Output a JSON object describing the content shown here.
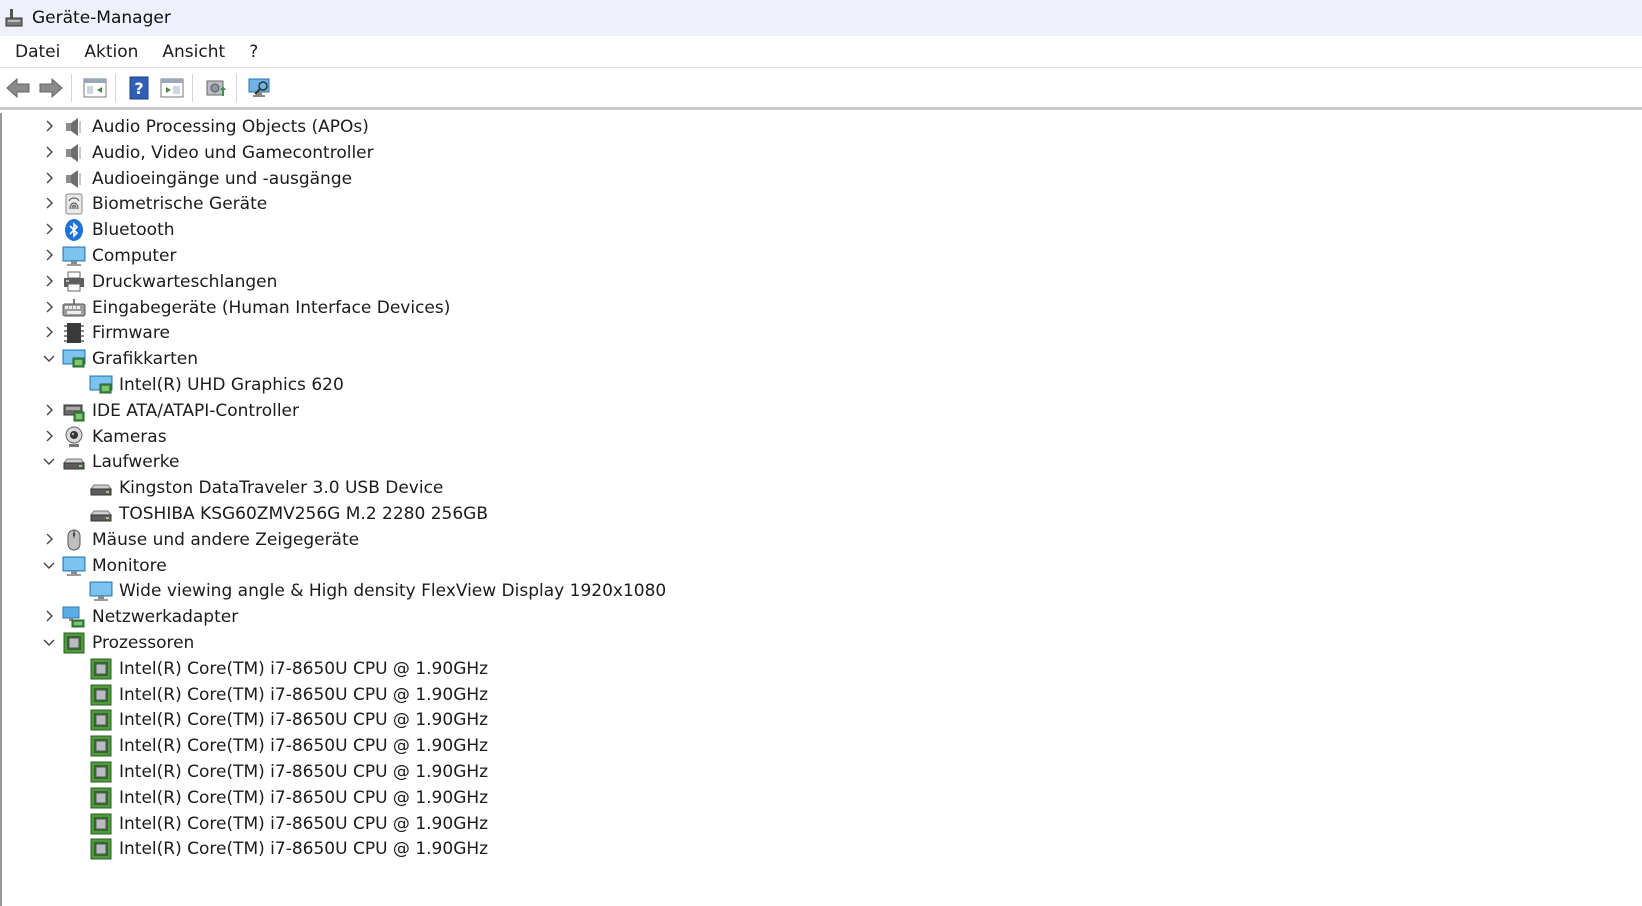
{
  "window": {
    "title": "Geräte-Manager"
  },
  "menu": [
    "Datei",
    "Aktion",
    "Ansicht",
    "?"
  ],
  "toolbar": [
    "back-icon",
    "forward-icon",
    "properties-view-icon",
    "help-icon",
    "details-view-icon",
    "update-driver-icon",
    "scan-hardware-icon"
  ],
  "tree": [
    {
      "label": "Audio Processing Objects (APOs)",
      "icon": "speaker",
      "level": 0,
      "state": "collapsed"
    },
    {
      "label": "Audio, Video und Gamecontroller",
      "icon": "speaker",
      "level": 0,
      "state": "collapsed"
    },
    {
      "label": "Audioeingänge und -ausgänge",
      "icon": "speaker",
      "level": 0,
      "state": "collapsed"
    },
    {
      "label": "Biometrische Geräte",
      "icon": "fingerprint",
      "level": 0,
      "state": "collapsed"
    },
    {
      "label": "Bluetooth",
      "icon": "bluetooth",
      "level": 0,
      "state": "collapsed"
    },
    {
      "label": "Computer",
      "icon": "monitor",
      "level": 0,
      "state": "collapsed"
    },
    {
      "label": "Druckwarteschlangen",
      "icon": "printer",
      "level": 0,
      "state": "collapsed"
    },
    {
      "label": "Eingabegeräte (Human Interface Devices)",
      "icon": "hid",
      "level": 0,
      "state": "collapsed"
    },
    {
      "label": "Firmware",
      "icon": "firmware",
      "level": 0,
      "state": "collapsed"
    },
    {
      "label": "Grafikkarten",
      "icon": "display-adapter",
      "level": 0,
      "state": "expanded"
    },
    {
      "label": "Intel(R) UHD Graphics 620",
      "icon": "display-adapter",
      "level": 1,
      "state": "leaf"
    },
    {
      "label": "IDE ATA/ATAPI-Controller",
      "icon": "ide",
      "level": 0,
      "state": "collapsed"
    },
    {
      "label": "Kameras",
      "icon": "camera",
      "level": 0,
      "state": "collapsed"
    },
    {
      "label": "Laufwerke",
      "icon": "drive",
      "level": 0,
      "state": "expanded"
    },
    {
      "label": "Kingston DataTraveler 3.0 USB Device",
      "icon": "drive",
      "level": 1,
      "state": "leaf"
    },
    {
      "label": "TOSHIBA KSG60ZMV256G M.2 2280 256GB",
      "icon": "drive",
      "level": 1,
      "state": "leaf"
    },
    {
      "label": "Mäuse und andere Zeigegeräte",
      "icon": "mouse",
      "level": 0,
      "state": "collapsed"
    },
    {
      "label": "Monitore",
      "icon": "monitor",
      "level": 0,
      "state": "expanded"
    },
    {
      "label": "Wide viewing angle & High density FlexView Display 1920x1080",
      "icon": "monitor",
      "level": 1,
      "state": "leaf"
    },
    {
      "label": "Netzwerkadapter",
      "icon": "network",
      "level": 0,
      "state": "collapsed"
    },
    {
      "label": "Prozessoren",
      "icon": "cpu",
      "level": 0,
      "state": "expanded"
    },
    {
      "label": "Intel(R) Core(TM) i7-8650U CPU @ 1.90GHz",
      "icon": "cpu",
      "level": 1,
      "state": "leaf"
    },
    {
      "label": "Intel(R) Core(TM) i7-8650U CPU @ 1.90GHz",
      "icon": "cpu",
      "level": 1,
      "state": "leaf"
    },
    {
      "label": "Intel(R) Core(TM) i7-8650U CPU @ 1.90GHz",
      "icon": "cpu",
      "level": 1,
      "state": "leaf"
    },
    {
      "label": "Intel(R) Core(TM) i7-8650U CPU @ 1.90GHz",
      "icon": "cpu",
      "level": 1,
      "state": "leaf"
    },
    {
      "label": "Intel(R) Core(TM) i7-8650U CPU @ 1.90GHz",
      "icon": "cpu",
      "level": 1,
      "state": "leaf"
    },
    {
      "label": "Intel(R) Core(TM) i7-8650U CPU @ 1.90GHz",
      "icon": "cpu",
      "level": 1,
      "state": "leaf"
    },
    {
      "label": "Intel(R) Core(TM) i7-8650U CPU @ 1.90GHz",
      "icon": "cpu",
      "level": 1,
      "state": "leaf"
    },
    {
      "label": "Intel(R) Core(TM) i7-8650U CPU @ 1.90GHz",
      "icon": "cpu",
      "level": 1,
      "state": "leaf"
    }
  ]
}
